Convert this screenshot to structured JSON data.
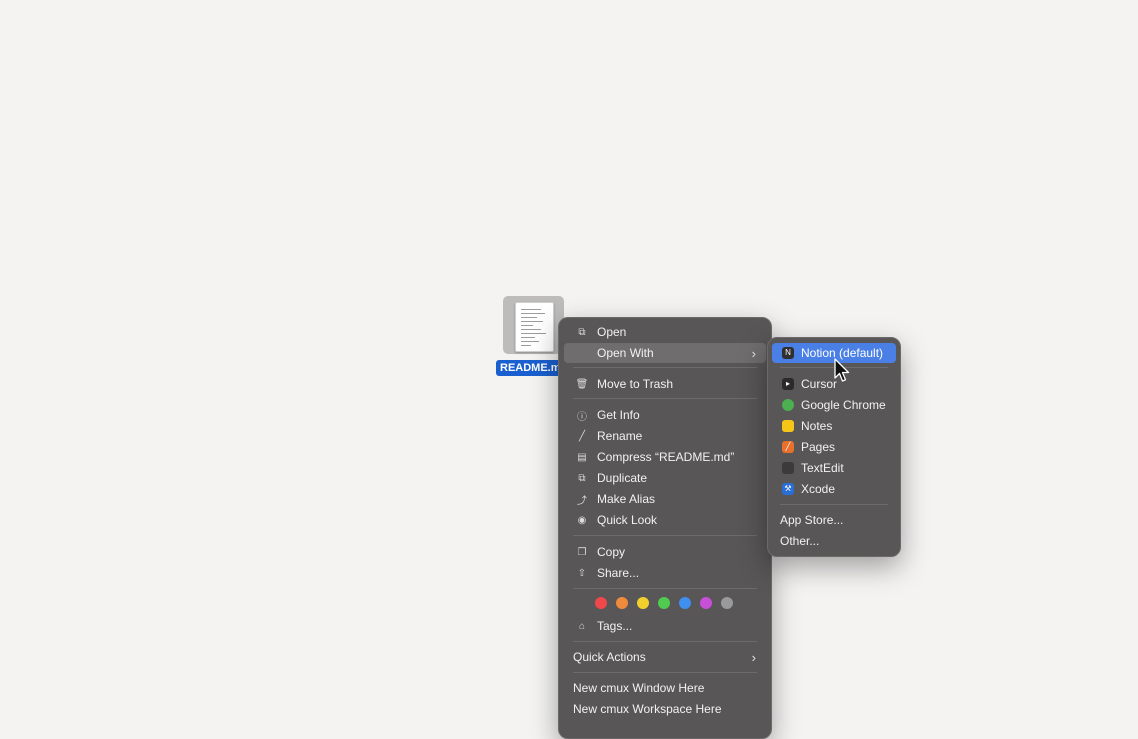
{
  "desktop": {
    "file": {
      "label": "README.md"
    }
  },
  "context_menu": {
    "items": [
      {
        "label": "Open",
        "icon": "open-icon"
      },
      {
        "label": "Open With",
        "has_submenu": true
      },
      {
        "label": "Move to Trash",
        "icon": "trash-icon"
      },
      {
        "label": "Get Info",
        "icon": "info-icon"
      },
      {
        "label": "Rename",
        "icon": "pencil-icon"
      },
      {
        "label": "Compress “README.md”",
        "icon": "archive-icon"
      },
      {
        "label": "Duplicate",
        "icon": "duplicate-icon"
      },
      {
        "label": "Make Alias",
        "icon": "alias-icon"
      },
      {
        "label": "Quick Look",
        "icon": "eye-icon"
      },
      {
        "label": "Copy",
        "icon": "copy-icon"
      },
      {
        "label": "Share...",
        "icon": "share-icon"
      },
      {
        "label": "Tags...",
        "icon": "tag-icon"
      },
      {
        "label": "Quick Actions",
        "has_submenu": true
      },
      {
        "label": "New cmux Window Here"
      },
      {
        "label": "New cmux Workspace Here"
      }
    ],
    "tag_colors": [
      "#f0474b",
      "#f08a3c",
      "#f3cf2e",
      "#4fcb4f",
      "#3f8ff0",
      "#c84fd8",
      "#9a999b"
    ]
  },
  "open_with_submenu": {
    "apps": [
      {
        "label": "Notion (default)",
        "icon": "notion-icon",
        "color": "#2f2f2f",
        "selected": true
      },
      {
        "label": "Cursor",
        "icon": "cursor-app-icon",
        "color": "#2b2b2b"
      },
      {
        "label": "Google Chrome",
        "icon": "chrome-icon",
        "color": "#4caf50"
      },
      {
        "label": "Notes",
        "icon": "notes-icon",
        "color": "#f5c518"
      },
      {
        "label": "Pages",
        "icon": "pages-icon",
        "color": "#e8702a"
      },
      {
        "label": "TextEdit",
        "icon": "textedit-icon",
        "color": "#3b3b3b"
      },
      {
        "label": "Xcode",
        "icon": "xcode-icon",
        "color": "#2a6fd8"
      }
    ],
    "app_store_label": "App Store...",
    "other_label": "Other..."
  }
}
